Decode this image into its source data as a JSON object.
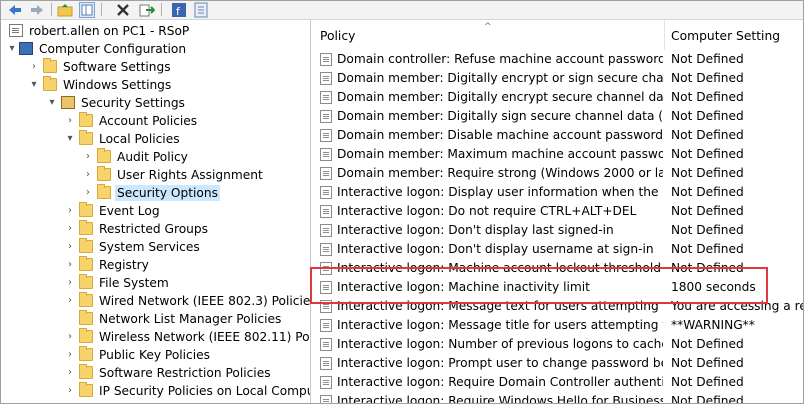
{
  "toolbar": {
    "buttons": [
      "back-icon",
      "forward-icon",
      "up-folder-icon",
      "show-hide-tree-icon",
      "delete-icon",
      "export-list-icon",
      "help-icon",
      "properties-icon"
    ]
  },
  "tree": {
    "items": [
      {
        "label": "robert.allen on PC1 - RSoP",
        "depth": 0,
        "expander": "",
        "icon": "doc-icon"
      },
      {
        "label": "Computer Configuration",
        "depth": 0,
        "expander": "▾",
        "icon": "computer-icon"
      },
      {
        "label": "Software Settings",
        "depth": 1,
        "expander": "›",
        "icon": "folder-icon"
      },
      {
        "label": "Windows Settings",
        "depth": 1,
        "expander": "▾",
        "icon": "folder-icon"
      },
      {
        "label": "Security Settings",
        "depth": 2,
        "expander": "▾",
        "icon": "security-icon"
      },
      {
        "label": "Account Policies",
        "depth": 3,
        "expander": "›",
        "icon": "folder-icon"
      },
      {
        "label": "Local Policies",
        "depth": 3,
        "expander": "▾",
        "icon": "folder-icon"
      },
      {
        "label": "Audit Policy",
        "depth": 4,
        "expander": "›",
        "icon": "folder-icon"
      },
      {
        "label": "User Rights Assignment",
        "depth": 4,
        "expander": "›",
        "icon": "folder-icon"
      },
      {
        "label": "Security Options",
        "depth": 4,
        "expander": "›",
        "icon": "folder-icon",
        "selected": true
      },
      {
        "label": "Event Log",
        "depth": 3,
        "expander": "›",
        "icon": "folder-icon"
      },
      {
        "label": "Restricted Groups",
        "depth": 3,
        "expander": "›",
        "icon": "folder-icon"
      },
      {
        "label": "System Services",
        "depth": 3,
        "expander": "›",
        "icon": "folder-icon"
      },
      {
        "label": "Registry",
        "depth": 3,
        "expander": "›",
        "icon": "folder-icon"
      },
      {
        "label": "File System",
        "depth": 3,
        "expander": "›",
        "icon": "folder-icon"
      },
      {
        "label": "Wired Network (IEEE 802.3) Policies",
        "depth": 3,
        "expander": "›",
        "icon": "folder-icon"
      },
      {
        "label": "Network List Manager Policies",
        "depth": 3,
        "expander": "",
        "icon": "folder-icon"
      },
      {
        "label": "Wireless Network (IEEE 802.11) Policies",
        "depth": 3,
        "expander": "›",
        "icon": "folder-icon"
      },
      {
        "label": "Public Key Policies",
        "depth": 3,
        "expander": "›",
        "icon": "folder-icon"
      },
      {
        "label": "Software Restriction Policies",
        "depth": 3,
        "expander": "›",
        "icon": "folder-icon"
      },
      {
        "label": "IP Security Policies on Local Computer",
        "depth": 3,
        "expander": "›",
        "icon": "folder-icon"
      }
    ]
  },
  "list": {
    "columns": [
      "Policy",
      "Computer Setting"
    ],
    "rows": [
      {
        "policy": "Domain controller: Refuse machine account password chan...",
        "setting": "Not Defined"
      },
      {
        "policy": "Domain member: Digitally encrypt or sign secure channel d...",
        "setting": "Not Defined"
      },
      {
        "policy": "Domain member: Digitally encrypt secure channel data (wh...",
        "setting": "Not Defined"
      },
      {
        "policy": "Domain member: Digitally sign secure channel data (when ...",
        "setting": "Not Defined"
      },
      {
        "policy": "Domain member: Disable machine account password chan...",
        "setting": "Not Defined"
      },
      {
        "policy": "Domain member: Maximum machine account password age",
        "setting": "Not Defined"
      },
      {
        "policy": "Domain member: Require strong (Windows 2000 or later) se...",
        "setting": "Not Defined"
      },
      {
        "policy": "Interactive logon: Display user information when the session...",
        "setting": "Not Defined"
      },
      {
        "policy": "Interactive logon: Do not require CTRL+ALT+DEL",
        "setting": "Not Defined"
      },
      {
        "policy": "Interactive logon: Don't display last signed-in",
        "setting": "Not Defined"
      },
      {
        "policy": "Interactive logon: Don't display username at sign-in",
        "setting": "Not Defined"
      },
      {
        "policy": "Interactive logon: Machine account lockout threshold",
        "setting": "Not Defined"
      },
      {
        "policy": "Interactive logon: Machine inactivity limit",
        "setting": "1800 seconds"
      },
      {
        "policy": "Interactive logon: Message text for users attempting to log on",
        "setting": "You are accessing a restric"
      },
      {
        "policy": "Interactive logon: Message title for users attempting to log on",
        "setting": "**WARNING**"
      },
      {
        "policy": "Interactive logon: Number of previous logons to cache (in c...",
        "setting": "Not Defined"
      },
      {
        "policy": "Interactive logon: Prompt user to change password before e...",
        "setting": "Not Defined"
      },
      {
        "policy": "Interactive logon: Require Domain Controller authentication...",
        "setting": "Not Defined"
      },
      {
        "policy": "Interactive logon: Require Windows Hello for Business or sm...",
        "setting": "Not Defined"
      }
    ]
  },
  "colors": {
    "selection": "#cce8ff",
    "highlight_border": "#e0383e"
  }
}
